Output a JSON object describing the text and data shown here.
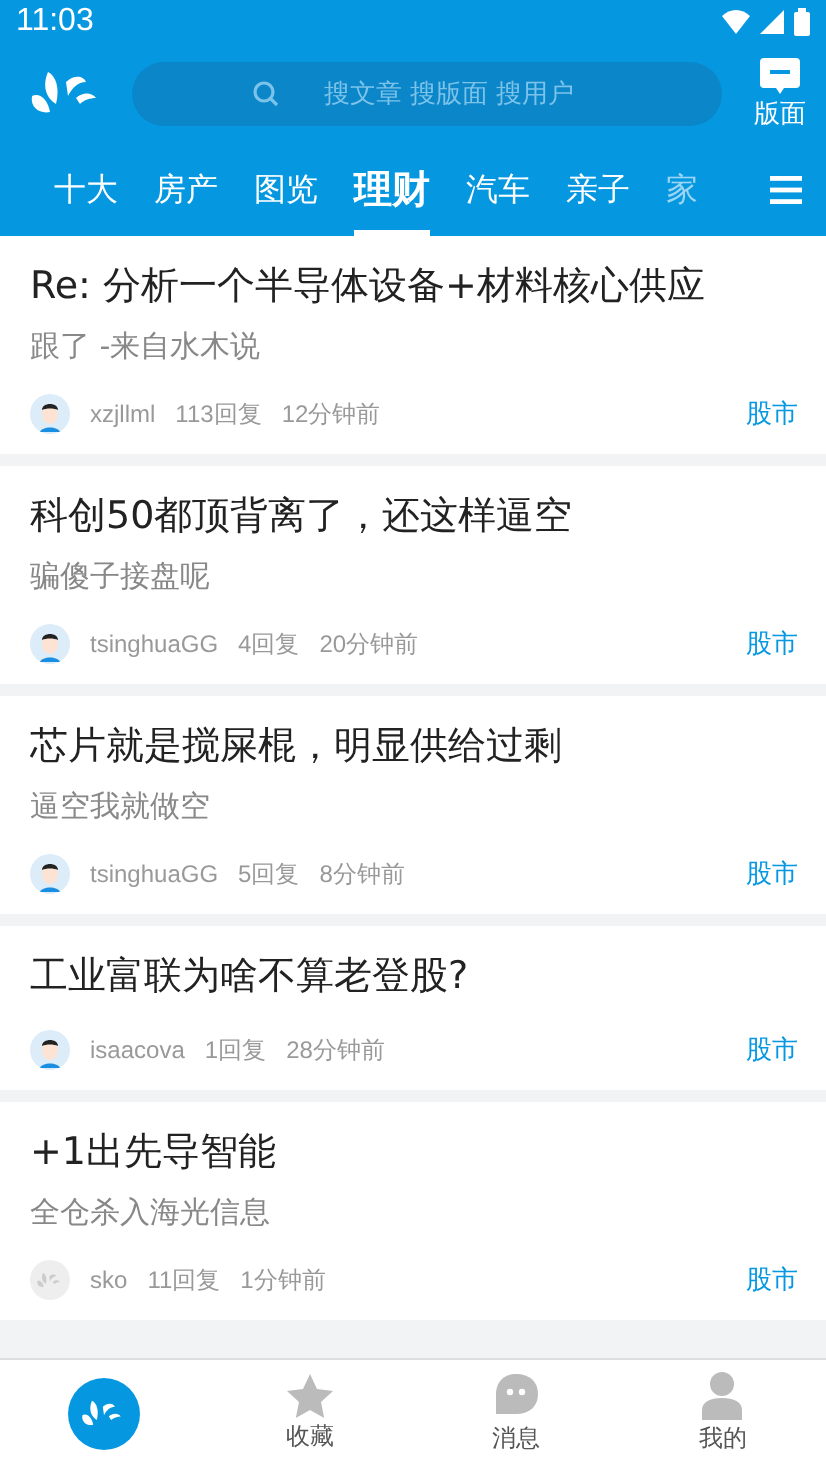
{
  "status_bar": {
    "time": "11:03"
  },
  "header": {
    "search": {
      "placeholder": "搜文章 搜版面 搜用户"
    },
    "board_button": "版面"
  },
  "tabs": [
    {
      "label": "十大",
      "selected": false
    },
    {
      "label": "房产",
      "selected": false
    },
    {
      "label": "图览",
      "selected": false
    },
    {
      "label": "理财",
      "selected": true
    },
    {
      "label": "汽车",
      "selected": false
    },
    {
      "label": "亲子",
      "selected": false
    },
    {
      "label": "家",
      "selected": false
    }
  ],
  "posts": [
    {
      "title": "Re: 分析一个半导体设备+材料核心供应",
      "summary": "跟了 -来自水木说",
      "kind": "person",
      "author": "xzjllml",
      "replies": "113回复",
      "time": "12分钟前",
      "board": "股市"
    },
    {
      "title": "科创50都顶背离了，还这样逼空",
      "summary": "骗傻子接盘呢",
      "kind": "person",
      "author": "tsinghuaGG",
      "replies": "4回复",
      "time": "20分钟前",
      "board": "股市"
    },
    {
      "title": "芯片就是搅屎棍，明显供给过剩",
      "summary": "逼空我就做空",
      "kind": "person",
      "author": "tsinghuaGG",
      "replies": "5回复",
      "time": "8分钟前",
      "board": "股市"
    },
    {
      "title": "工业富联为啥不算老登股?",
      "kind": "person",
      "author": "isaacova",
      "replies": "1回复",
      "time": "28分钟前",
      "board": "股市"
    },
    {
      "title": "+1出先导智能",
      "summary": "全仓杀入海光信息",
      "kind": "default",
      "author": "sko",
      "replies": "11回复",
      "time": "1分钟前",
      "board": "股市"
    }
  ],
  "bottom_nav": [
    {
      "kind": "home",
      "selected": true
    },
    {
      "kind": "star",
      "label": "收藏",
      "selected": false
    },
    {
      "kind": "message",
      "label": "消息",
      "selected": false
    },
    {
      "kind": "person",
      "label": "我的",
      "selected": false
    }
  ]
}
